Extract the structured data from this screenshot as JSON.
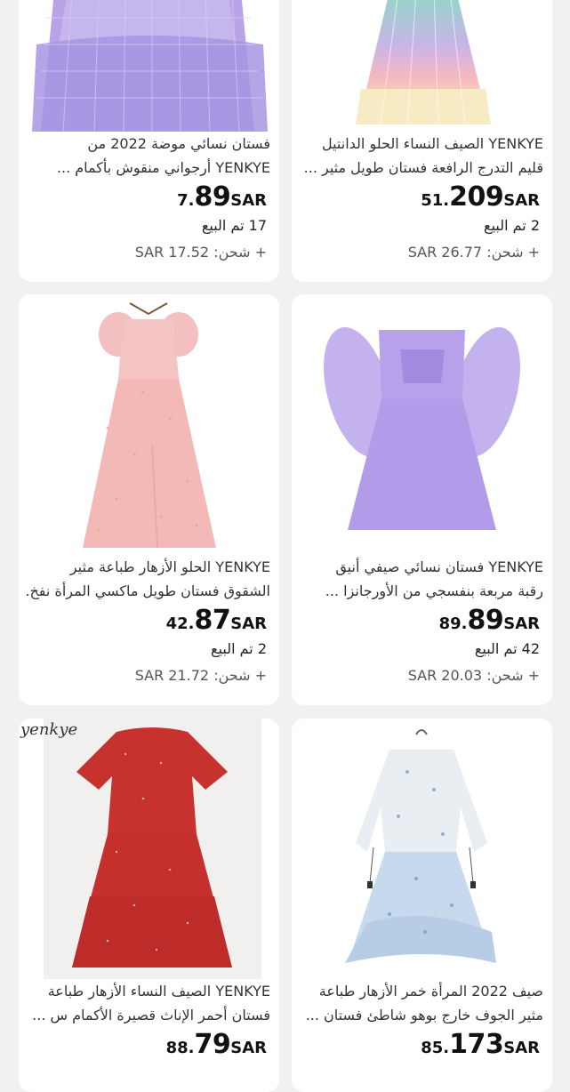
{
  "products": [
    {
      "title_line1": "فستان نسائي موضة 2022 من",
      "title_line2": "YENKYE أرجواني منقوش بأكمام ...",
      "price_int": "7.",
      "price_main": "89",
      "currency": "SAR",
      "sold": "17 تم البيع",
      "shipping": "+ شحن: SAR 17.52",
      "image": "purple-tulle-dress-image",
      "color": "#b8a6e8"
    },
    {
      "title_line1": "YENKYE الصيف النساء الحلو الدانتيل",
      "title_line2": "قليم التدرج الرافعة فستان طويل مثير ...",
      "price_int": "51.",
      "price_main": "209",
      "currency": "SAR",
      "sold": "2 تم البيع",
      "shipping": "+ شحن: SAR 26.77",
      "image": "gradient-lace-dress-image",
      "color": "#9fd8c9"
    },
    {
      "title_line1": "YENKYE الحلو الأزهار طباعة مثير",
      "title_line2": "الشقوق فستان طويل ماكسي المرأة نفخ...",
      "price_int": "42.",
      "price_main": "87",
      "currency": "SAR",
      "sold": "2 تم البيع",
      "shipping": "+ شحن: SAR 21.72",
      "image": "pink-floral-maxi-dress-image",
      "color": "#f1b9b9"
    },
    {
      "title_line1": "YENKYE فستان نسائي صيفي أنيق",
      "title_line2": "رقبة مربعة بنفسجي من الأورجانزا ...",
      "price_int": "89.",
      "price_main": "89",
      "currency": "SAR",
      "sold": "42 تم البيع",
      "shipping": "+ شحن: SAR 20.03",
      "image": "lilac-organza-mini-dress-image",
      "color": "#b9a3ec"
    },
    {
      "title_line1": "YENKYE الصيف النساء الأزهار طباعة",
      "title_line2": "فستان أحمر الإناث قصيرة الأكمام س ...",
      "price_int": "88.",
      "price_main": "79",
      "currency": "SAR",
      "image": "red-polka-dress-image",
      "brand_watermark": "yenkye",
      "color": "#c8322e"
    },
    {
      "title_line1": "صيف 2022 المرأة خمر الأزهار طباعة",
      "title_line2": "مثير الجوف خارج بوهو شاطئ فستان ...",
      "price_int": "85.",
      "price_main": "173",
      "currency": "SAR",
      "image": "blue-boho-floral-dress-image",
      "color": "#a9c7e6"
    }
  ]
}
